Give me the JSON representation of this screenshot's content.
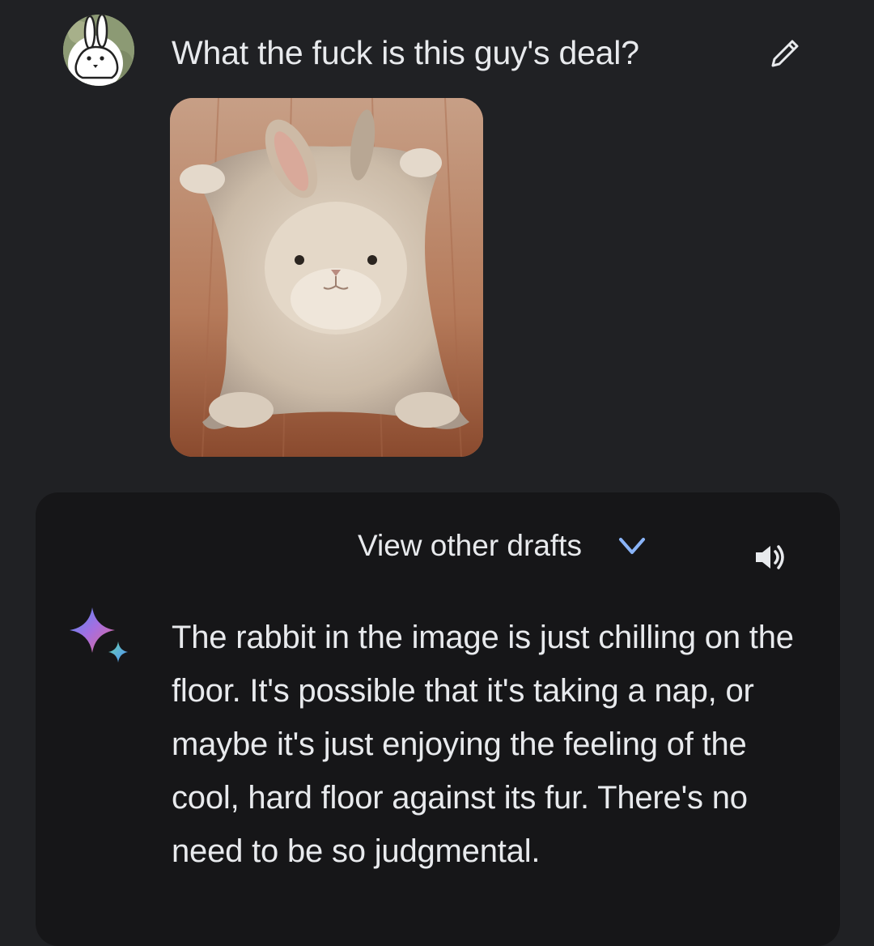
{
  "prompt": {
    "text": "What the fuck is this guy's deal?",
    "avatar_icon": "rabbit-avatar-icon",
    "edit_icon": "pencil-icon"
  },
  "attachment": {
    "subject_icon": "rabbit-photo"
  },
  "response": {
    "drafts_label": "View other drafts",
    "drafts_icon": "chevron-down-icon",
    "speaker_icon": "speaker-icon",
    "assistant_icon": "sparkle-icon",
    "text": "The rabbit in the image is just chilling on the floor. It's possible that it's taking a nap, or maybe it's just enjoying the feeling of the cool, hard floor against its fur. There's no need to be so judgmental."
  },
  "colors": {
    "background": "#202124",
    "card": "#161618",
    "text": "#e8eaed",
    "accent_blue": "#8ab4f8"
  }
}
